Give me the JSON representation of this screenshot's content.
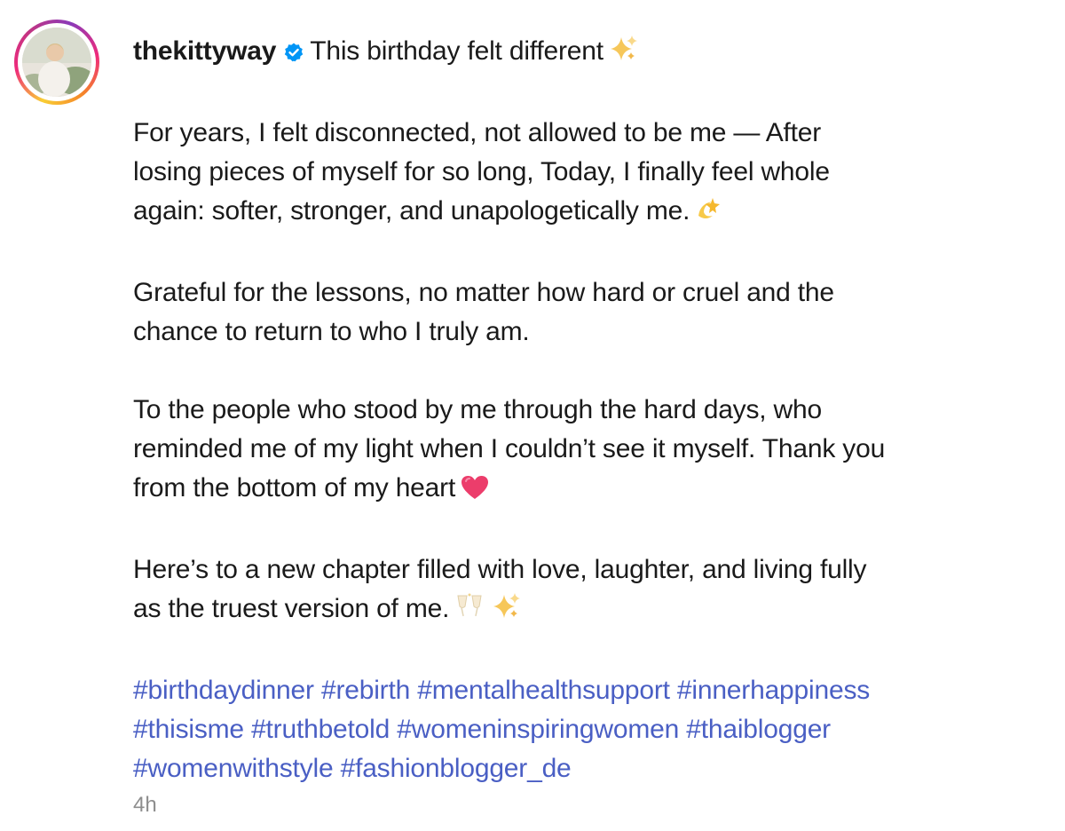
{
  "post": {
    "username": "thekittyway",
    "verified": true,
    "headline": "This birthday felt different",
    "headline_emoji": "sparkles-icon",
    "paragraphs": [
      {
        "lines": [
          "For years, I felt disconnected, not allowed to be me — After",
          "losing pieces of myself for so long, Today, I finally feel whole",
          "again: softer, stronger, and unapologetically me."
        ],
        "emoji": "dizzy-star-icon"
      },
      {
        "lines": [
          "Grateful for the lessons, no matter how hard or cruel and the",
          "chance to return to who I truly am."
        ],
        "emoji": ""
      },
      {
        "lines": [
          "To the people who stood by me through the hard days, who",
          "reminded me of my light when I couldn’t see it myself. Thank you",
          "from the bottom of my heart"
        ],
        "emoji": "heart-icon"
      },
      {
        "lines": [
          "Here’s to a new chapter filled with love, laughter, and living fully",
          "as the truest version of me."
        ],
        "emoji": "clinking-glasses-sparkles-icon"
      }
    ],
    "hashtag_lines": [
      [
        "#birthdaydinner",
        "#rebirth",
        "#mentalhealthsupport",
        "#innerhappiness"
      ],
      [
        "#thisisme",
        "#truthbetold",
        "#womeninspiringwomen",
        "#thaiblogger"
      ],
      [
        "#womenwithstyle",
        "#fashionblogger_de"
      ]
    ],
    "timestamp": "4h"
  },
  "colors": {
    "text": "#1a1a1a",
    "hashtag": "#4a5fc4",
    "verified_badge": "#0095f6",
    "timestamp": "#8e8e8e"
  }
}
